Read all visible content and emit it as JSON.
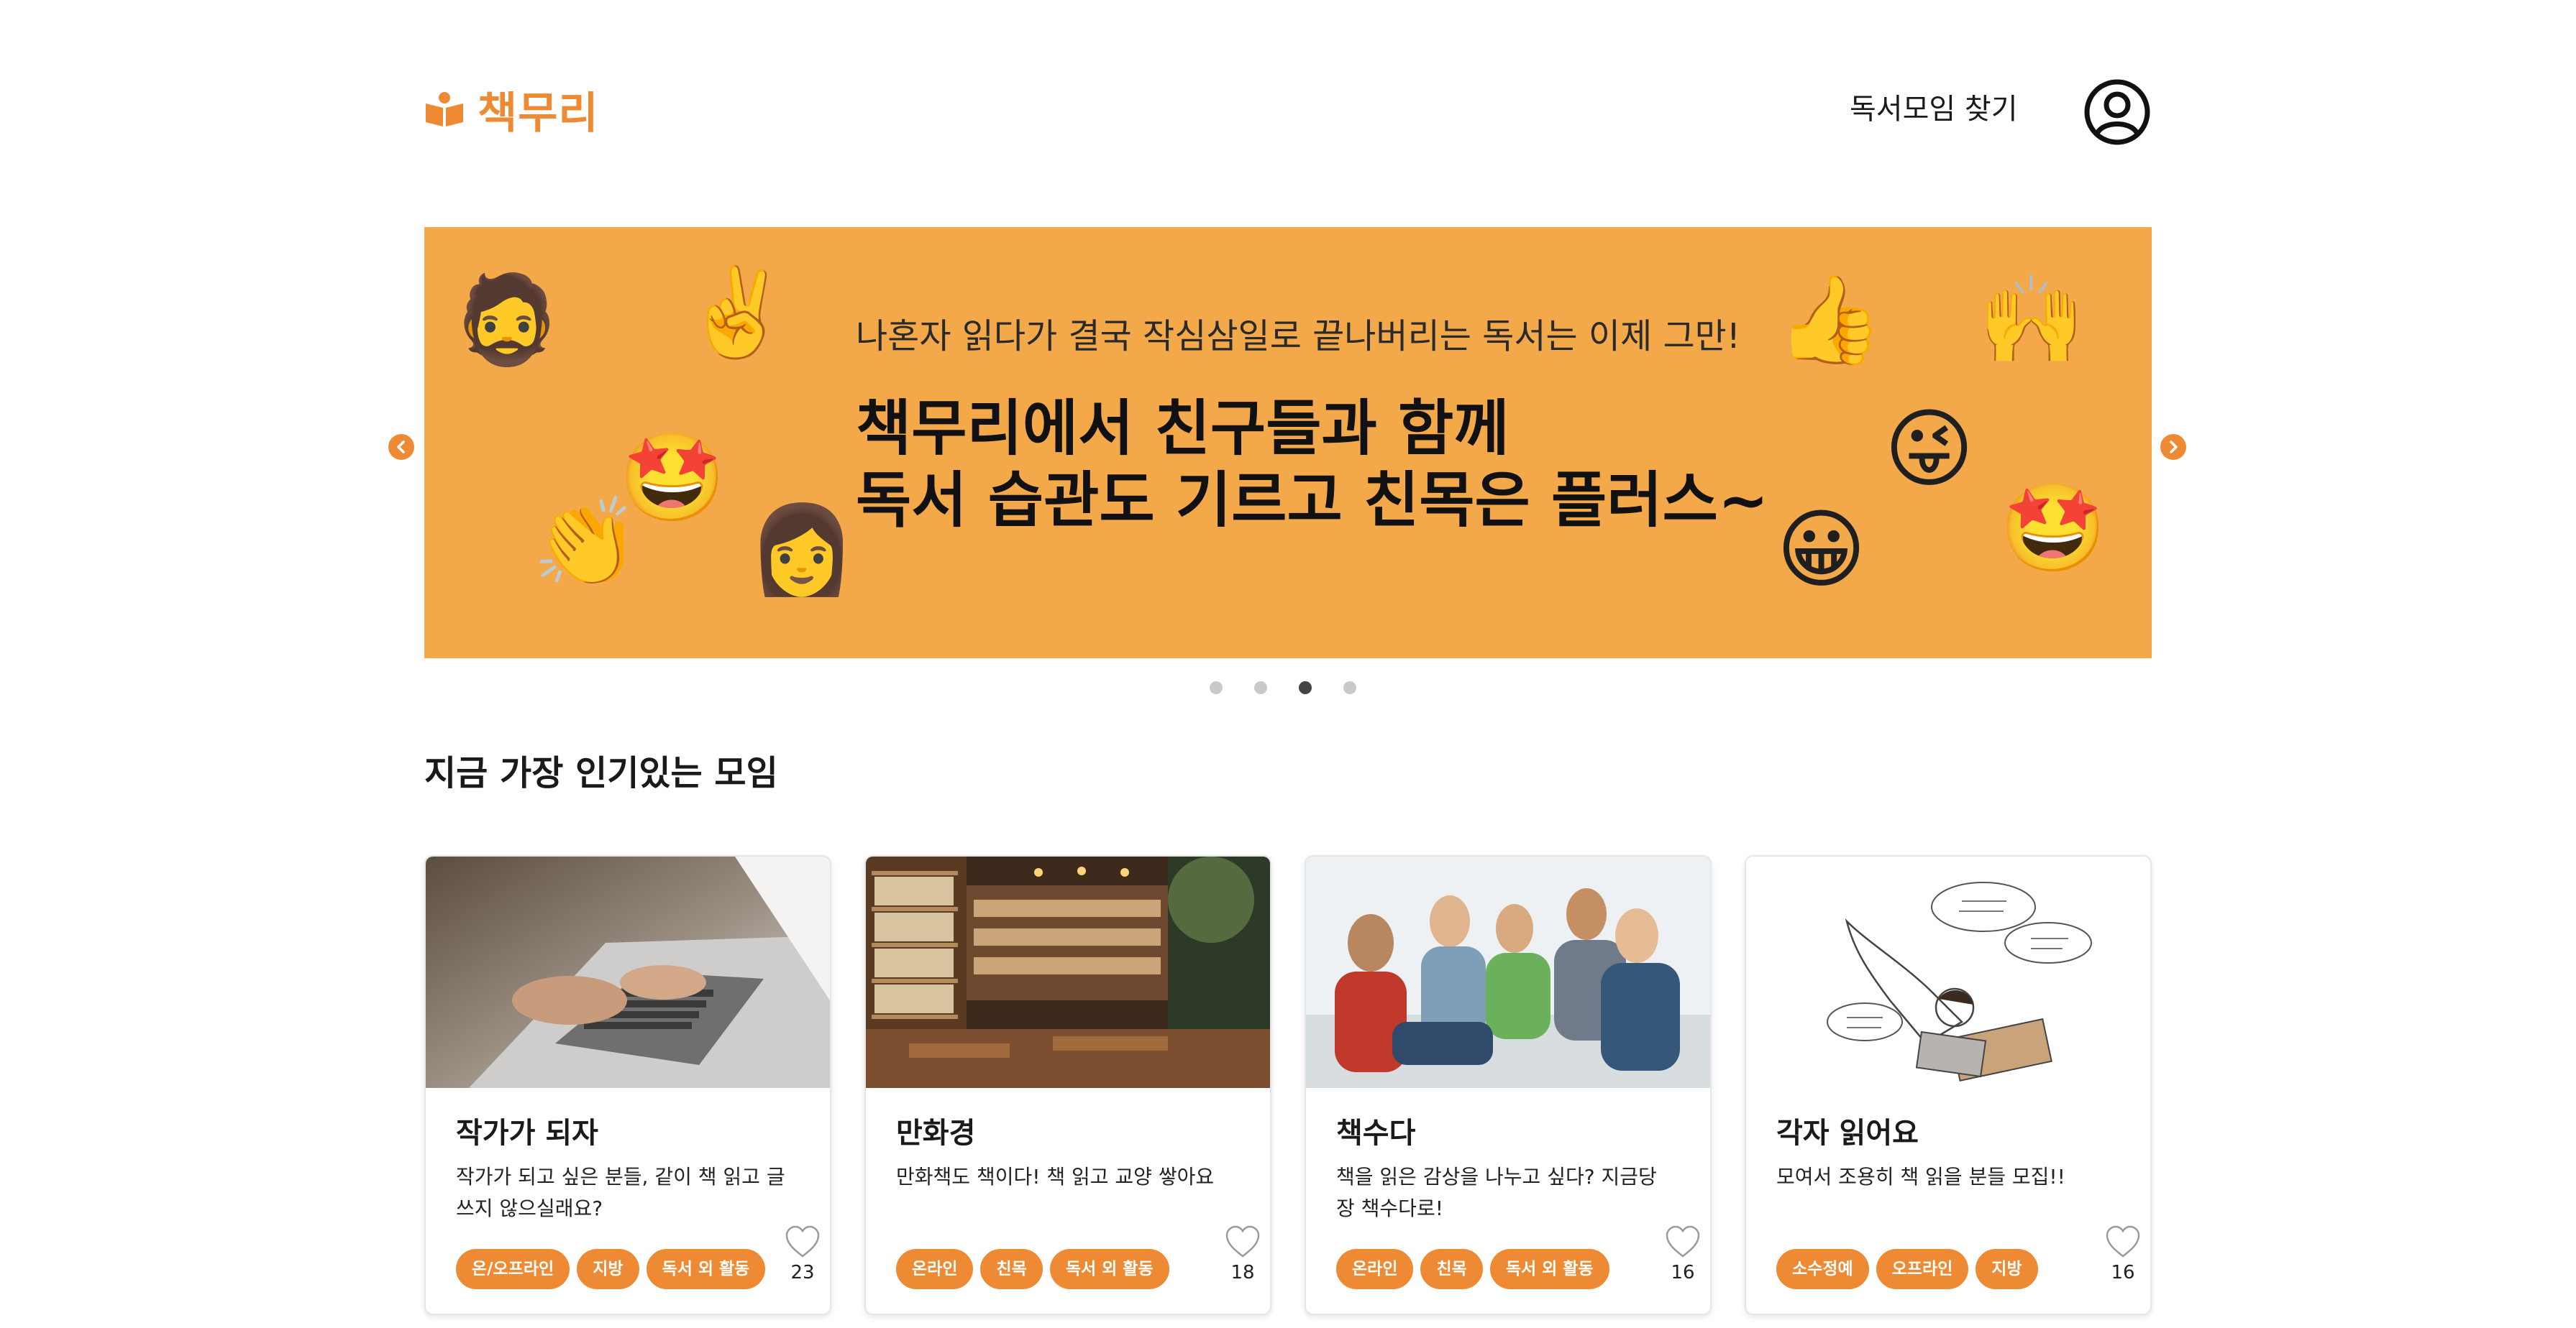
{
  "header": {
    "logo_text": "책무리",
    "nav_find": "독서모임 찾기",
    "profile_icon": "user-circle-icon"
  },
  "banner": {
    "subtitle": "나혼자 읽다가 결국 작심삼일로 끝나버리는 독서는 이제 그만!",
    "title_line1": "책무리에서 친구들과 함께",
    "title_line2": "독서 습관도 기르고 친목은 플러스~",
    "background": "#f3a84a",
    "slides_count": 4,
    "active_slide": 3
  },
  "section": {
    "title": "지금 가장 인기있는 모임"
  },
  "cards": [
    {
      "title": "작가가 되자",
      "description": "작가가 되고 싶은 분들, 같이 책 읽고 글 쓰지 않으실래요?",
      "tags": [
        "온/오프라인",
        "지방",
        "독서 외 활동"
      ],
      "likes": "23",
      "image": "laptop-typing-photo"
    },
    {
      "title": "만화경",
      "description": "만화책도 책이다! 책 읽고 교양 쌓아요",
      "tags": [
        "온라인",
        "친목",
        "독서 외 활동"
      ],
      "likes": "18",
      "image": "comic-cafe-photo"
    },
    {
      "title": "책수다",
      "description": "책을 읽은 감상을 나누고 싶다? 지금당장 책수다로!",
      "tags": [
        "온라인",
        "친목",
        "독서 외 활동"
      ],
      "likes": "16",
      "image": "friends-talking-photo"
    },
    {
      "title": "각자 읽어요",
      "description": "모여서 조용히 책 읽을 분들 모집!!",
      "tags": [
        "소수정예",
        "오프라인",
        "지방"
      ],
      "likes": "16",
      "image": "reading-illustration"
    }
  ],
  "colors": {
    "accent": "#ee8a33",
    "banner": "#f3a84a"
  }
}
